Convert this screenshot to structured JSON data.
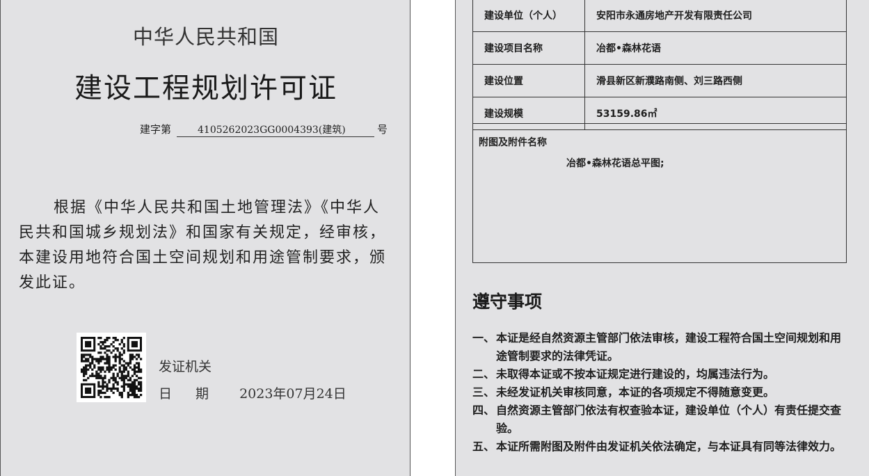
{
  "certificate": {
    "country": "中华人民共和国",
    "title": "建设工程规划许可证",
    "number_prefix": "建字第",
    "number": "4105262023GG0004393(建筑)",
    "number_suffix": "号",
    "body": "根据《中华人民共和国土地管理法》《中华人民共和国城乡规划法》和国家有关规定，经审核，本建设用地符合国土空间规划和用途管制要求，颁发此证。",
    "issuer_label": "发证机关",
    "date_label": "日期",
    "date_value": "2023年07月24日",
    "qr_icon": "qr-code-icon"
  },
  "info_table": {
    "rows": [
      {
        "label": "建设单位（个人）",
        "value": "安阳市永通房地产开发有限责任公司"
      },
      {
        "label": "建设项目名称",
        "value": "冶都•森林花语"
      },
      {
        "label": "建设位置",
        "value": "滑县新区新濮路南侧、刘三路西侧"
      },
      {
        "label": "建设规模",
        "value": "53159.86㎡"
      }
    ],
    "attachments_label": "附图及附件名称",
    "attachments_value": "冶都•森林花语总平图;"
  },
  "rules": {
    "title": "遵守事项",
    "items": [
      {
        "marker": "一、",
        "text": "本证是经自然资源主管部门依法审核，建设工程符合国土空间规划和用途管制要求的法律凭证。"
      },
      {
        "marker": "二、",
        "text": "未取得本证或不按本证规定进行建设的，均属违法行为。"
      },
      {
        "marker": "三、",
        "text": "未经发证机关审核同意，本证的各项规定不得随意变更。"
      },
      {
        "marker": "四、",
        "text": "自然资源主管部门依法有权查验本证，建设单位（个人）有责任提交查验。"
      },
      {
        "marker": "五、",
        "text": "本证所需附图及附件由发证机关依法确定，与本证具有同等法律效力。"
      }
    ]
  }
}
